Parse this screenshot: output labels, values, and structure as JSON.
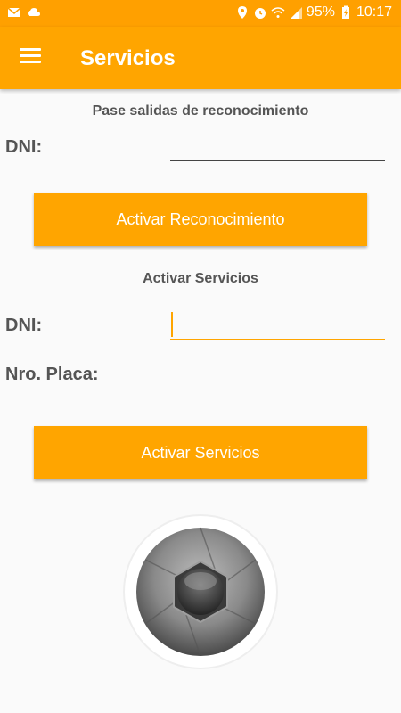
{
  "status_bar": {
    "battery": "95%",
    "time": "10:17"
  },
  "app_bar": {
    "title": "Servicios",
    "menu_icon": "hamburger-menu-icon"
  },
  "recognition_section": {
    "title": "Pase salidas de reconocimiento",
    "dni_label": "DNI:",
    "dni_value": "",
    "button_label": "Activar Reconocimiento"
  },
  "services_section": {
    "title": "Activar Servicios",
    "dni_label": "DNI:",
    "dni_value": "",
    "placa_label": "Nro. Placa:",
    "placa_value": "",
    "button_label": "Activar Servicios"
  },
  "camera": {
    "icon": "camera-shutter-icon"
  },
  "colors": {
    "accent": "#ffa500",
    "status_bar": "#ffa000"
  }
}
